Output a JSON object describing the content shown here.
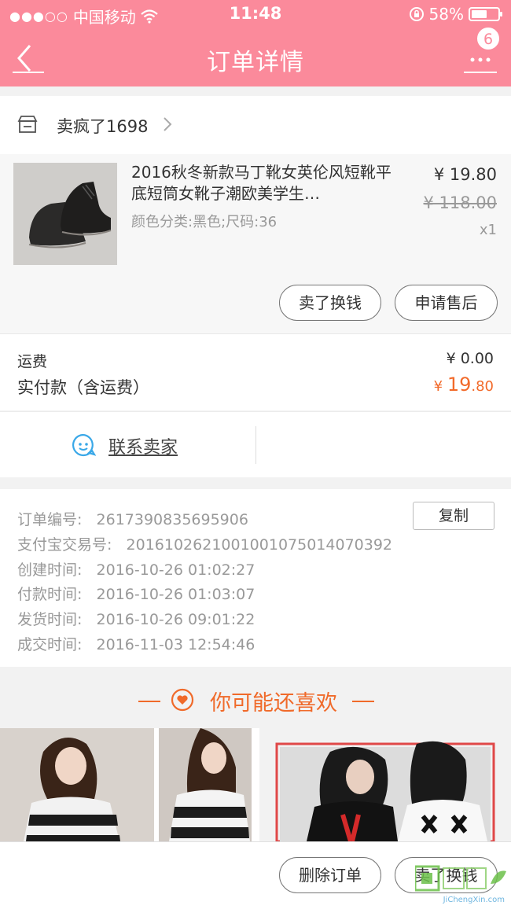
{
  "status_bar": {
    "carrier": "中国移动",
    "time": "11:48",
    "battery": "58%",
    "battery_level": 0.58
  },
  "nav": {
    "title": "订单详情",
    "badge_count": "6"
  },
  "shop": {
    "name": "卖疯了1698"
  },
  "product": {
    "title": "2016秋冬新款马丁靴女英伦风短靴平底短筒女靴子潮欧美学生…",
    "sku": "颜色分类:黑色;尺码:36",
    "price": "¥ 19.80",
    "original_price": "¥ 118.00",
    "quantity": "x1",
    "sell_button": "卖了换钱",
    "after_sale_button": "申请售后"
  },
  "fees": {
    "shipping_label": "运费",
    "shipping_value": "¥ 0.00",
    "paid_label": "实付款（含运费）",
    "paid_currency": "¥ ",
    "paid_integer": "19",
    "paid_decimal": ".80"
  },
  "contact": {
    "label": "联系卖家"
  },
  "order_info": {
    "copy_button": "复制",
    "rows": [
      {
        "label": "订单编号:",
        "value": "2617390835695906"
      },
      {
        "label": "支付宝交易号:",
        "value": "2016102621001001075014070392"
      },
      {
        "label": "创建时间:",
        "value": "2016-10-26 01:02:27"
      },
      {
        "label": "付款时间:",
        "value": "2016-10-26 01:03:07"
      },
      {
        "label": "发货时间:",
        "value": "2016-10-26 09:01:22"
      },
      {
        "label": "成交时间:",
        "value": "2016-11-03 12:54:46"
      }
    ]
  },
  "recommend": {
    "title": "你可能还喜欢"
  },
  "bottom": {
    "delete_button": "删除订单",
    "sell_button": "卖了换钱"
  },
  "watermark": {
    "text": "JiChengXin.com"
  },
  "colors": {
    "brand_pink": "#fb8a9b",
    "price_orange": "#f26a2a"
  }
}
